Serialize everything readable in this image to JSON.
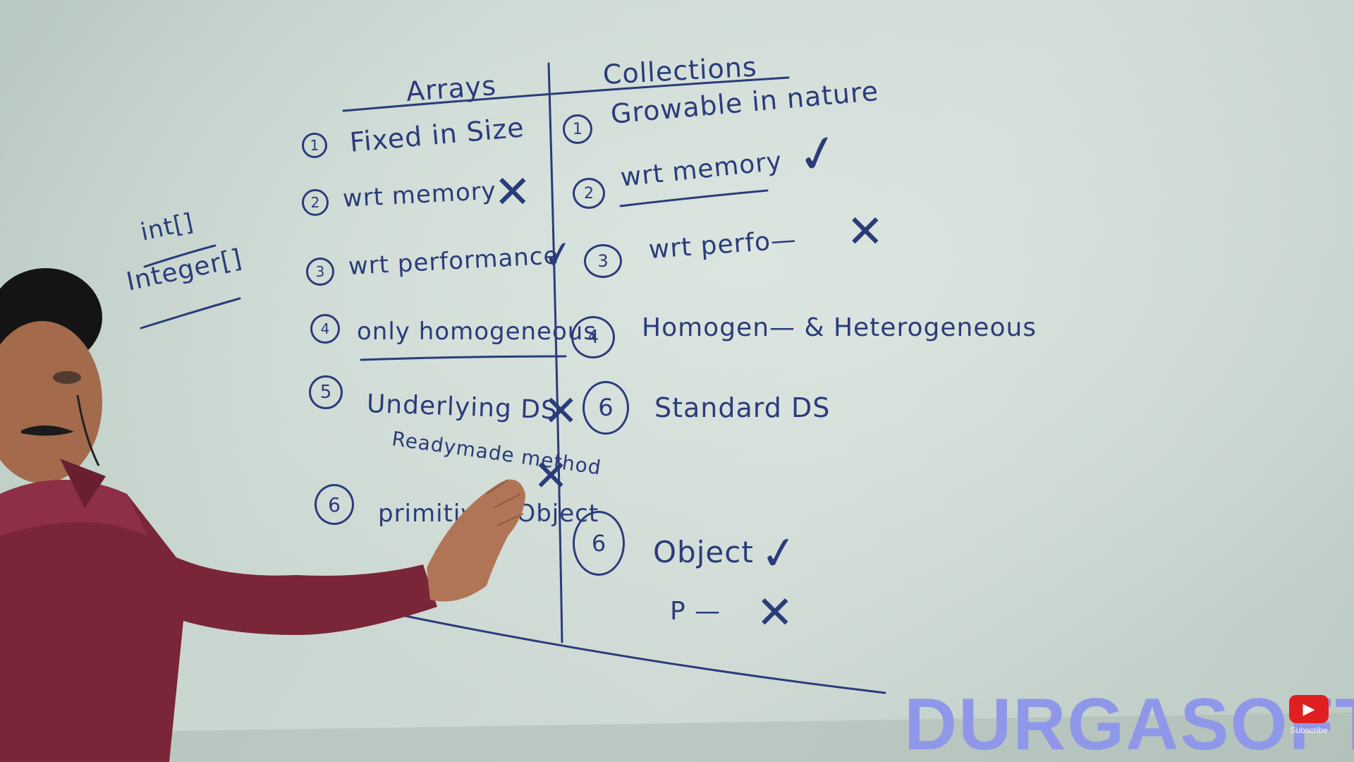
{
  "board": {
    "header_arrays": "Arrays",
    "header_collections": "Collections",
    "side_note_1": "int[]",
    "side_note_2": "Integer[]",
    "arrays_points": [
      {
        "num": "1",
        "text": "Fixed in Size"
      },
      {
        "num": "2",
        "text": "wrt memory",
        "mark": "✕"
      },
      {
        "num": "3",
        "text": "wrt performance",
        "mark": "✓"
      },
      {
        "num": "4",
        "text": "only homogeneous"
      },
      {
        "num": "5",
        "text": "Underlying DS",
        "mark": "✕"
      },
      {
        "num": "",
        "text": "Readymade method",
        "mark": "✕"
      },
      {
        "num": "6",
        "text": "primitive / Object"
      }
    ],
    "collections_points": [
      {
        "num": "1",
        "text": "Growable in nature"
      },
      {
        "num": "2",
        "text": "wrt memory",
        "mark": "✓"
      },
      {
        "num": "3",
        "text": "wrt perfo—",
        "mark": "✕"
      },
      {
        "num": "4",
        "text": "Homogen— & Heterogeneous"
      },
      {
        "num": "6",
        "text": "Standard DS"
      },
      {
        "num": "6",
        "text": "Object",
        "mark": "✓"
      },
      {
        "num": "",
        "text": "P —",
        "mark": "✕"
      }
    ]
  },
  "overlay": {
    "brand": "DURGASOFT",
    "subscribe_label": "Subscribe",
    "subscribe_icon": "youtube-play-icon",
    "brand_color": "#8f98e8"
  }
}
